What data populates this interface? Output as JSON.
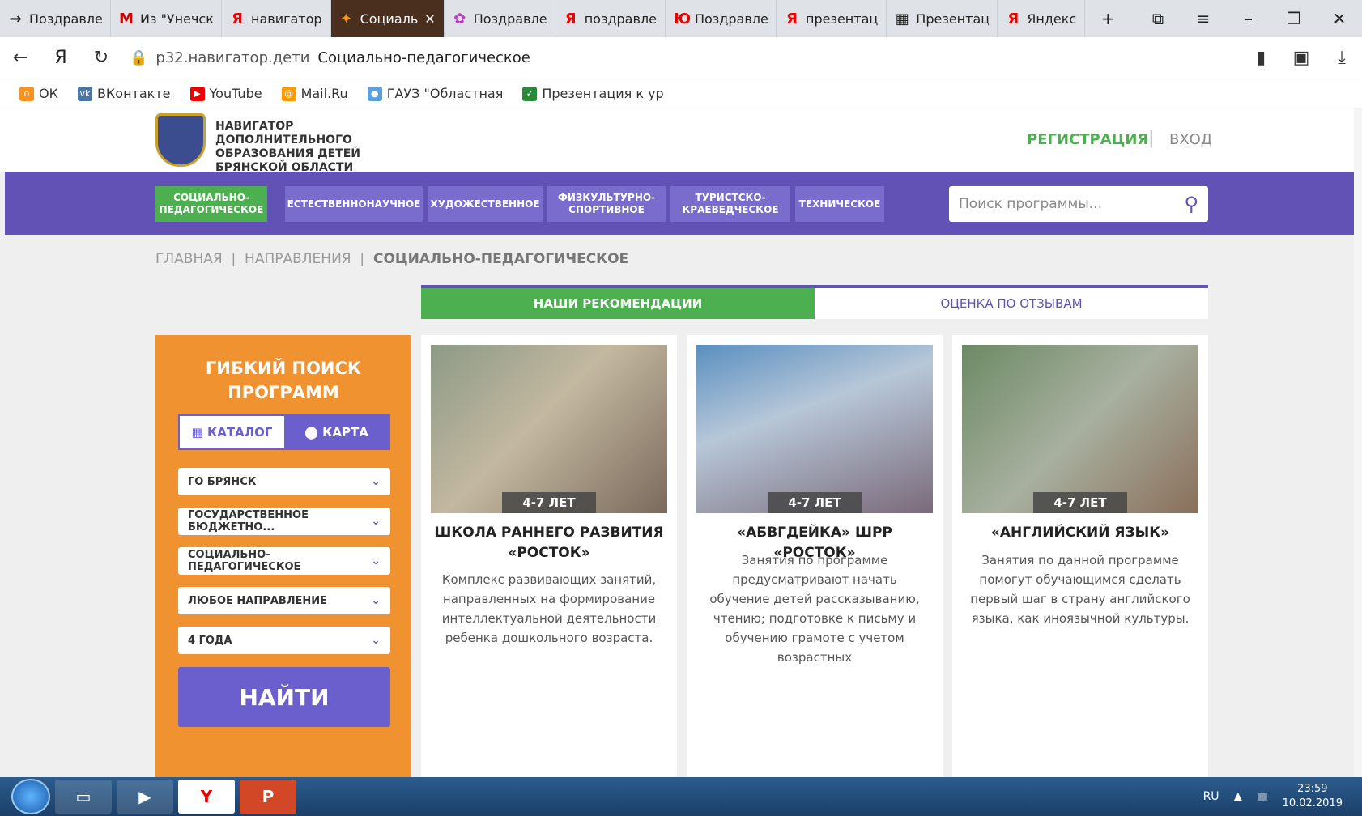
{
  "tabs": [
    {
      "label": "Поздравле",
      "icon": "→"
    },
    {
      "label": "Из \"Унечск",
      "icon": "M"
    },
    {
      "label": "навигатор",
      "icon": "Я"
    },
    {
      "label": "Социаль",
      "icon": "✦",
      "active": true
    },
    {
      "label": "Поздравле",
      "icon": "✿"
    },
    {
      "label": "поздравле",
      "icon": "Я"
    },
    {
      "label": "Поздравле",
      "icon": "Ю"
    },
    {
      "label": "презентац",
      "icon": "Я"
    },
    {
      "label": "Презентац",
      "icon": "▦"
    },
    {
      "label": "Яндекс",
      "icon": "Я"
    }
  ],
  "address": {
    "domain": "р32.навигатор.дети",
    "title": "Социально-педагогическое"
  },
  "bookmarks": [
    "ОК",
    "ВКонтакте",
    "YouTube",
    "Mail.Ru",
    "ГАУЗ \"Областная",
    "Презентация к ур"
  ],
  "header": {
    "logo_text": "НАВИГАТОР ДОПОЛНИТЕЛЬНОГО ОБРАЗОВАНИЯ ДЕТЕЙ БРЯНСКОЙ ОБЛАСТИ",
    "register": "РЕГИСТРАЦИЯ",
    "separator": "|",
    "login": "ВХОД"
  },
  "nav": {
    "items": [
      "СОЦИАЛЬНО-ПЕДАГОГИЧЕСКОЕ",
      "ЕСТЕСТВЕННОНАУЧНОЕ",
      "ХУДОЖЕСТВЕННОЕ",
      "ФИЗКУЛЬТУРНО-СПОРТИВНОЕ",
      "ТУРИСТСКО-КРАЕВЕДЧЕСКОЕ",
      "ТЕХНИЧЕСКОЕ"
    ],
    "search_placeholder": "Поиск программы..."
  },
  "breadcrumbs": {
    "home": "ГЛАВНАЯ",
    "dirs": "НАПРАВЛЕНИЯ",
    "current": "СОЦИАЛЬНО-ПЕДАГОГИЧЕСКОЕ",
    "sep": "|"
  },
  "view_tabs": {
    "recommend": "НАШИ РЕКОМЕНДАЦИИ",
    "reviews": "ОЦЕНКА ПО ОТЗЫВАМ"
  },
  "filter": {
    "title": "ГИБКИЙ ПОИСК ПРОГРАММ",
    "catalog": "КАТАЛОГ",
    "map": "КАРТА",
    "selects": [
      "ГО БРЯНСК",
      "ГОСУДАРСТВЕННОЕ БЮДЖЕТНО...",
      "СОЦИАЛЬНО-ПЕДАГОГИЧЕСКОЕ",
      "ЛЮБОЕ НАПРАВЛЕНИЕ",
      "4 ГОДА"
    ],
    "find": "НАЙТИ"
  },
  "cards": [
    {
      "age": "4-7 ЛЕТ",
      "title": "ШКОЛА РАННЕГО РАЗВИТИЯ «РОСТОК»",
      "desc": "Комплекс развивающих занятий, направленных на формирование интеллектуальной деятельности ребенка дошкольного возраста."
    },
    {
      "age": "4-7 ЛЕТ",
      "title": "«АБВГДЕЙКА» ШРР «РОСТОК»",
      "desc": "Занятия по программе предусматривают начать обучение детей рассказыванию, чтению; подготовке к письму и обучению грамоте с учетом возрастных"
    },
    {
      "age": "4-7 ЛЕТ",
      "title": "«АНГЛИЙСКИЙ ЯЗЫК»",
      "desc": "Занятия по данной программе помогут обучающимся сделать первый шаг в страну английского языка, как иноязычной культуры."
    }
  ],
  "taskbar": {
    "lang": "RU",
    "time": "23:59",
    "date": "10.02.2019"
  },
  "colors": {
    "purple": "#6252b5",
    "green": "#4caf50",
    "orange": "#f0922f"
  }
}
